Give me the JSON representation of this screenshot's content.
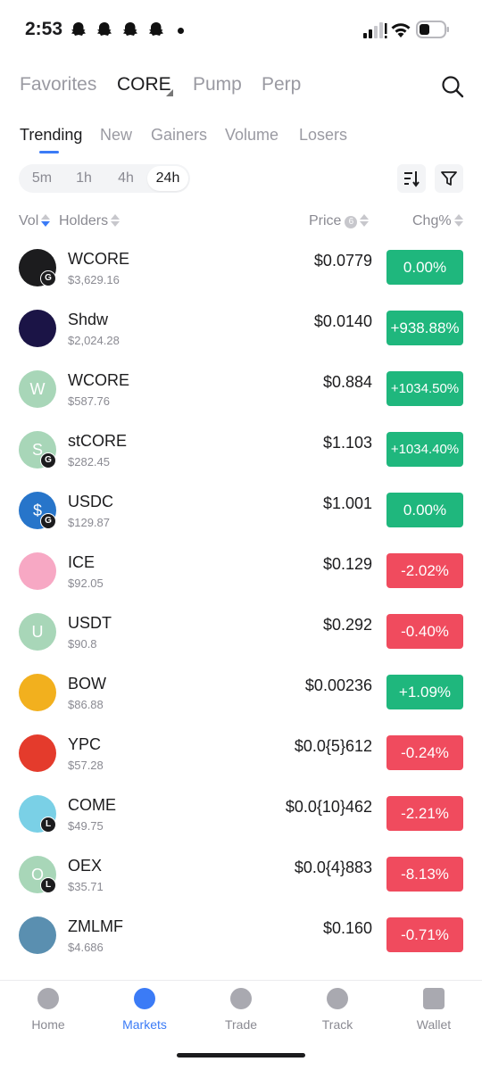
{
  "status": {
    "time": "2:53"
  },
  "top_tabs": [
    {
      "label": "Favorites",
      "active": false
    },
    {
      "label": "CORE",
      "active": true
    },
    {
      "label": "Pump",
      "active": false
    },
    {
      "label": "Perp",
      "active": false
    }
  ],
  "sub_tabs": [
    {
      "label": "Trending",
      "active": true
    },
    {
      "label": "New",
      "active": false
    },
    {
      "label": "Gainers",
      "active": false
    },
    {
      "label": "Volume",
      "active": false
    },
    {
      "label": "Losers",
      "active": false
    }
  ],
  "time_ranges": [
    {
      "label": "5m",
      "active": false
    },
    {
      "label": "1h",
      "active": false
    },
    {
      "label": "4h",
      "active": false
    },
    {
      "label": "24h",
      "active": true
    }
  ],
  "columns": {
    "vol": "Vol",
    "holders": "Holders",
    "price": "Price",
    "price_badge": "6",
    "chg": "Chg%"
  },
  "tokens": [
    {
      "symbol": "WCORE",
      "volume": "$3,629.16",
      "price": "$0.0779",
      "change": "0.00%",
      "direction": "up",
      "avatar_color": "#1c1c1e",
      "avatar_letter": "",
      "badge": "G"
    },
    {
      "symbol": "Shdw",
      "volume": "$2,024.28",
      "price": "$0.0140",
      "change": "+938.88%",
      "direction": "up",
      "avatar_color": "#1b1446",
      "avatar_letter": "",
      "badge": ""
    },
    {
      "symbol": "WCORE",
      "volume": "$587.76",
      "price": "$0.884",
      "change": "+1034.50%",
      "direction": "up",
      "avatar_color": "#a8d6b8",
      "avatar_letter": "W",
      "badge": ""
    },
    {
      "symbol": "stCORE",
      "volume": "$282.45",
      "price": "$1.103",
      "change": "+1034.40%",
      "direction": "up",
      "avatar_color": "#a8d6b8",
      "avatar_letter": "S",
      "badge": "G"
    },
    {
      "symbol": "USDC",
      "volume": "$129.87",
      "price": "$1.001",
      "change": "0.00%",
      "direction": "up",
      "avatar_color": "#2775ca",
      "avatar_letter": "$",
      "badge": "G"
    },
    {
      "symbol": "ICE",
      "volume": "$92.05",
      "price": "$0.129",
      "change": "-2.02%",
      "direction": "down",
      "avatar_color": "#f7a8c4",
      "avatar_letter": "",
      "badge": ""
    },
    {
      "symbol": "USDT",
      "volume": "$90.8",
      "price": "$0.292",
      "change": "-0.40%",
      "direction": "down",
      "avatar_color": "#a8d6b8",
      "avatar_letter": "U",
      "badge": ""
    },
    {
      "symbol": "BOW",
      "volume": "$86.88",
      "price": "$0.00236",
      "change": "+1.09%",
      "direction": "up",
      "avatar_color": "#f2b01e",
      "avatar_letter": "",
      "badge": ""
    },
    {
      "symbol": "YPC",
      "volume": "$57.28",
      "price": "$0.0{5}612",
      "change": "-0.24%",
      "direction": "down",
      "avatar_color": "#e43b2c",
      "avatar_letter": "",
      "badge": ""
    },
    {
      "symbol": "COME",
      "volume": "$49.75",
      "price": "$0.0{10}462",
      "change": "-2.21%",
      "direction": "down",
      "avatar_color": "#7ad0e6",
      "avatar_letter": "",
      "badge": "L"
    },
    {
      "symbol": "OEX",
      "volume": "$35.71",
      "price": "$0.0{4}883",
      "change": "-8.13%",
      "direction": "down",
      "avatar_color": "#a8d6b8",
      "avatar_letter": "O",
      "badge": "L"
    },
    {
      "symbol": "ZMLMF",
      "volume": "$4.686",
      "price": "$0.160",
      "change": "-0.71%",
      "direction": "down",
      "avatar_color": "#5a8fb0",
      "avatar_letter": "",
      "badge": ""
    }
  ],
  "bottom_nav": [
    {
      "label": "Home",
      "icon": "home-icon",
      "active": false
    },
    {
      "label": "Markets",
      "icon": "markets-icon",
      "active": true
    },
    {
      "label": "Trade",
      "icon": "trade-icon",
      "active": false
    },
    {
      "label": "Track",
      "icon": "track-icon",
      "active": false
    },
    {
      "label": "Wallet",
      "icon": "wallet-icon",
      "active": false
    }
  ],
  "colors": {
    "accent": "#3b7bf6",
    "up": "#1fb77d",
    "down": "#f04b5e"
  }
}
